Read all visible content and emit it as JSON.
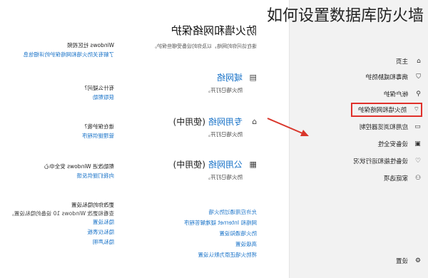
{
  "caption": "如何设置数据库防火墙",
  "nav": {
    "items": [
      {
        "label": "主页",
        "icon": "home-icon",
        "glyph": "⌂"
      },
      {
        "label": "病毒和威胁防护",
        "icon": "shield-icon",
        "glyph": "⛉"
      },
      {
        "label": "帐户保护",
        "icon": "person-icon",
        "glyph": "⚲"
      },
      {
        "label": "防火墙和网络保护",
        "icon": "wifi-icon",
        "glyph": "⌔"
      },
      {
        "label": "应用和浏览器控制",
        "icon": "app-icon",
        "glyph": "▭"
      },
      {
        "label": "设备安全性",
        "icon": "device-icon",
        "glyph": "▣"
      },
      {
        "label": "设备性能和运行状况",
        "icon": "heart-icon",
        "glyph": "♡"
      },
      {
        "label": "家庭选项",
        "icon": "family-icon",
        "glyph": "⚇"
      }
    ],
    "settings": {
      "label": "设置",
      "glyph": "⚙"
    }
  },
  "main": {
    "title": "防火墙和网络保护",
    "subtitle": "谁在访问你的网络，以及你的设备受哪些保护。",
    "networks": [
      {
        "name": "域网络",
        "tag": "",
        "status": "防火墙已打开。",
        "glyph": "▤"
      },
      {
        "name": "专用网络",
        "tag": "(使用中)",
        "status": "防火墙已打开。",
        "glyph": "⌂"
      },
      {
        "name": "公用网络",
        "tag": "(使用中)",
        "status": "防火墙已打开。",
        "glyph": "▦"
      }
    ],
    "links": [
      "允许应用通过防火墙",
      "网络和 Internet 疑难解答程序",
      "防火墙通知设置",
      "高级设置",
      "将防火墙还原为默认设置"
    ]
  },
  "side": {
    "groups": [
      {
        "heading": "Windows 社区视频",
        "body": "",
        "links": [
          "了解有关防火墙和网络保护的详细信息"
        ]
      },
      {
        "heading": "有什么疑问?",
        "body": "",
        "links": [
          "获取帮助"
        ]
      },
      {
        "heading": "谁在保护我?",
        "body": "",
        "links": [
          "管理提供程序"
        ]
      },
      {
        "heading": "帮助改进 Windows 安全中心",
        "body": "",
        "links": [
          "向我们提供反馈"
        ]
      },
      {
        "heading": "更改你的隐私设置",
        "body": "查看和更改 Windows 10 设备的隐私设置。",
        "links": [
          "隐私设置",
          "隐私仪表板",
          "隐私声明"
        ]
      }
    ]
  }
}
